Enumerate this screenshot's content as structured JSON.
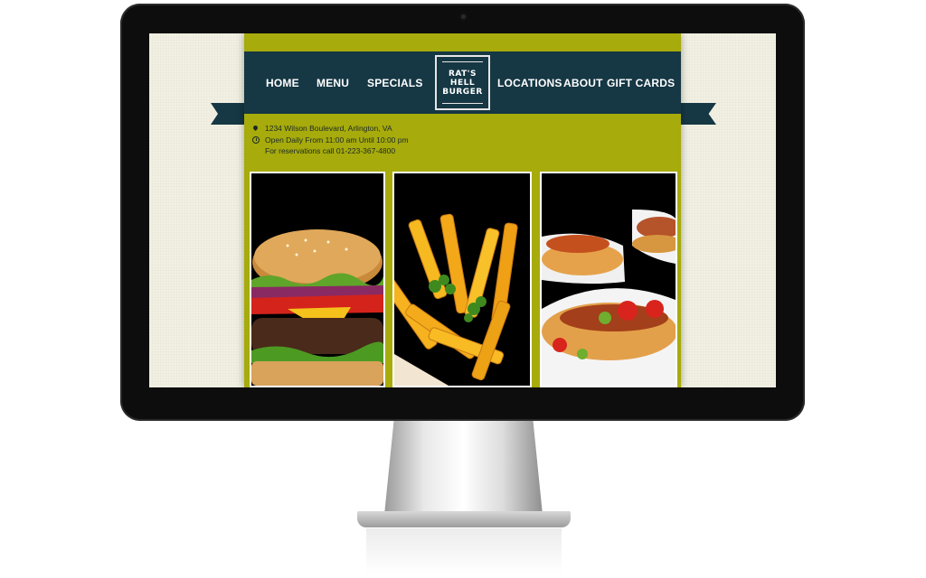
{
  "site": {
    "nav_left": [
      "HOME",
      "MENU",
      "SPECIALS"
    ],
    "nav_right": [
      "LOCATIONS",
      "ABOUT",
      "GIFT CARDS"
    ],
    "logo_lines": [
      "RAT'S",
      "HELL",
      "BURGER"
    ],
    "address": "1234 Wilson Boulevard, Arlington, VA",
    "hours": "Open Daily From 11:00 am Until 10:00 pm",
    "reservations": "For reservations call 01-223-367-4800"
  },
  "images": [
    "burger",
    "french fries",
    "hot dogs"
  ],
  "colors": {
    "olive": "#a7ab0b",
    "navy": "#163744",
    "background": "#f1f0e2"
  }
}
